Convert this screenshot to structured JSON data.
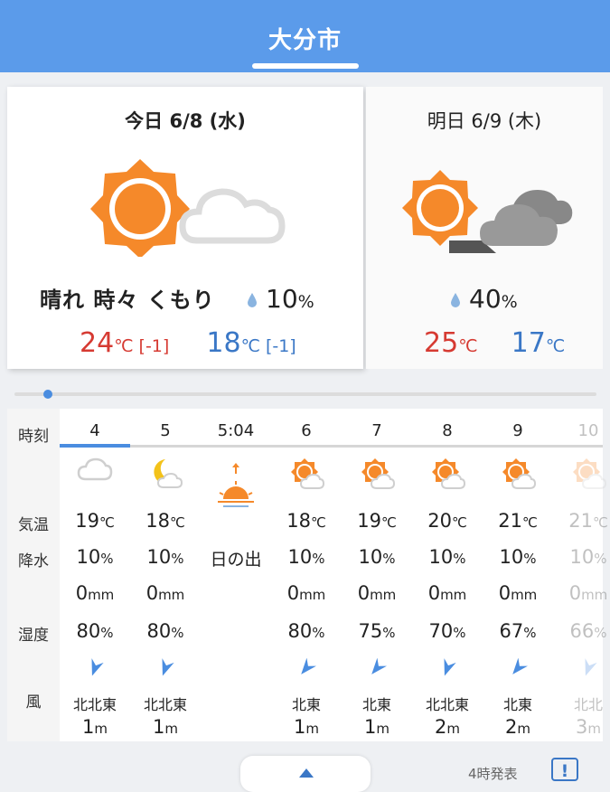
{
  "header": {
    "title": "大分市"
  },
  "today": {
    "date": "今日 6/8 (水)",
    "weather": "晴れ 時々 くもり",
    "precip_value": "10",
    "precip_unit": "%",
    "high": "24",
    "high_diff": "[-1]",
    "low": "18",
    "low_diff": "[-1]",
    "unit": "℃",
    "icon": "sun-then-cloud-icon"
  },
  "tomorrow": {
    "date": "明日 6/9 (木)",
    "precip_value": "40",
    "precip_unit": "%",
    "high": "25",
    "low": "17",
    "unit": "℃",
    "icon": "sun-then-cloudy-icon"
  },
  "hourly": {
    "labels": {
      "time": "時刻",
      "temp": "気温",
      "precip": "降水",
      "humidity": "湿度",
      "wind": "風"
    },
    "columns": [
      {
        "hour": "4",
        "icon": "cloud-icon",
        "temp": "19",
        "rain": "10",
        "mm": "0",
        "hum": "80",
        "dir": "北北東",
        "speed": "1"
      },
      {
        "hour": "5",
        "icon": "moon-cloud-icon",
        "temp": "18",
        "rain": "10",
        "mm": "0",
        "hum": "80",
        "dir": "北北東",
        "speed": "1"
      },
      {
        "hour": "5:04",
        "icon": "sunrise-icon",
        "label": "日の出"
      },
      {
        "hour": "6",
        "icon": "sun-cloud-icon",
        "temp": "18",
        "rain": "10",
        "mm": "0",
        "hum": "80",
        "dir": "北東",
        "speed": "1"
      },
      {
        "hour": "7",
        "icon": "sun-cloud-icon",
        "temp": "19",
        "rain": "10",
        "mm": "0",
        "hum": "75",
        "dir": "北東",
        "speed": "1"
      },
      {
        "hour": "8",
        "icon": "sun-cloud-icon",
        "temp": "20",
        "rain": "10",
        "mm": "0",
        "hum": "70",
        "dir": "北北東",
        "speed": "2"
      },
      {
        "hour": "9",
        "icon": "sun-cloud-icon",
        "temp": "21",
        "rain": "10",
        "mm": "0",
        "hum": "67",
        "dir": "北東",
        "speed": "2"
      },
      {
        "hour": "10",
        "icon": "sun-cloud-icon",
        "temp": "21",
        "rain": "10",
        "mm": "0",
        "hum": "66",
        "dir": "北北",
        "speed": "3"
      }
    ],
    "units": {
      "temp": "℃",
      "pct": "%",
      "mm": "mm",
      "speed": "m"
    }
  },
  "footer": {
    "issued": "4時発表",
    "alert_label": "!"
  },
  "colors": {
    "header": "#5b9bea",
    "accent": "#4a8de0",
    "high": "#d63a32",
    "low": "#3a77c6",
    "sun": "#f5892a"
  }
}
